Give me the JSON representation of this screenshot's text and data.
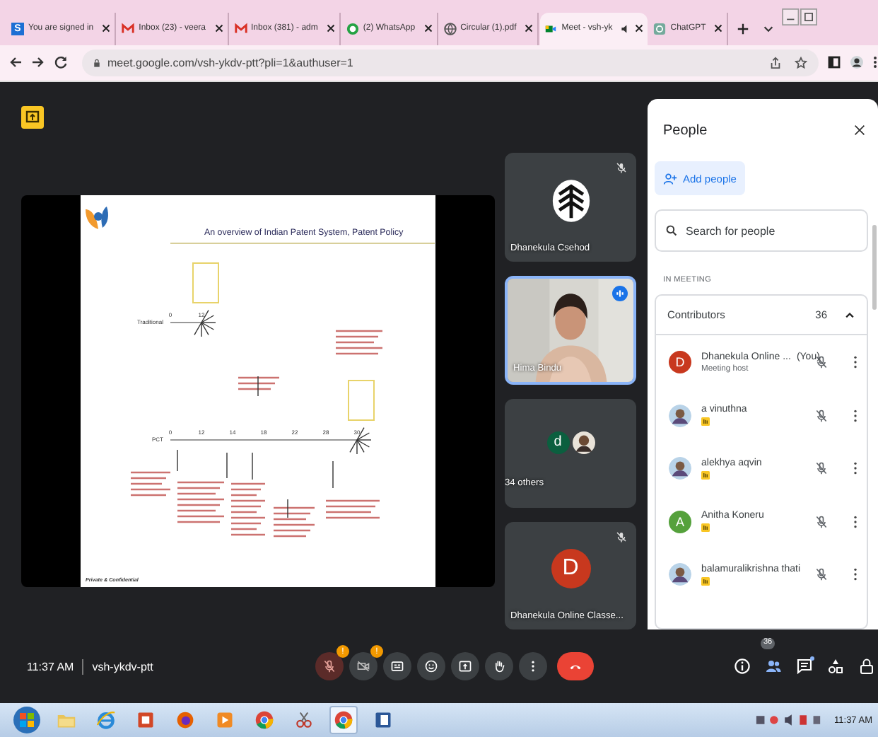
{
  "browser": {
    "tabs": [
      {
        "title": "You are signed in",
        "kind": "letter",
        "icon_text": "S",
        "selected": false
      },
      {
        "title": "Inbox (23) - veera",
        "kind": "mail",
        "selected": false
      },
      {
        "title": "Inbox (381) - adm",
        "kind": "mail",
        "selected": false
      },
      {
        "title": "(2) WhatsApp",
        "kind": "chat",
        "selected": false
      },
      {
        "title": "Circular (1).pdf",
        "kind": "globe",
        "selected": false
      },
      {
        "title": "Meet - vsh-yk",
        "kind": "meet",
        "audio": true,
        "selected": true
      },
      {
        "title": "ChatGPT",
        "kind": "bot",
        "selected": false
      }
    ],
    "url": "meet.google.com/vsh-ykdv-ptt?pli=1&authuser=1"
  },
  "presentation": {
    "title": "An overview of Indian Patent System, Patent Policy",
    "footer": "Private & Confidential",
    "timelines": [
      {
        "label": "Traditional",
        "ticks": [
          "0",
          "12"
        ]
      },
      {
        "label": "PCT",
        "ticks": [
          "0",
          "12",
          "14",
          "18",
          "22",
          "28",
          "30"
        ]
      }
    ]
  },
  "tiles": [
    {
      "kind": "logo",
      "name": "Dhanekula Csehod",
      "muted": true,
      "speaking": false
    },
    {
      "kind": "video",
      "name": "Hima Bindu",
      "muted": false,
      "speaking": true
    },
    {
      "kind": "group",
      "name": "34 others",
      "letter": "d",
      "muted": false,
      "speaking": false
    },
    {
      "kind": "avatar",
      "name": "Dhanekula Online Classe...",
      "letter": "D",
      "muted": true,
      "speaking": false
    }
  ],
  "people": {
    "title": "People",
    "add_button": "Add people",
    "search_placeholder": "Search for people",
    "section": "IN MEETING",
    "group": {
      "label": "Contributors",
      "count": "36",
      "expanded": true
    },
    "participants": [
      {
        "name": "Dhanekula Online ...",
        "you": "(You)",
        "role": "Meeting host",
        "avatar": {
          "kind": "letter",
          "letter": "D",
          "color": "#c8381e"
        },
        "muted": true,
        "badge": false
      },
      {
        "name": "a vinuthna",
        "muted": true,
        "badge": true
      },
      {
        "name": "alekhya aqvin",
        "muted": true,
        "badge": true
      },
      {
        "name": "Anitha Koneru",
        "avatar": {
          "kind": "letter",
          "letter": "A",
          "color": "#55a13c"
        },
        "muted": true,
        "badge": true
      },
      {
        "name": "balamuralikrishna thati",
        "muted": true,
        "badge": true
      }
    ]
  },
  "controls": {
    "time": "11:37 AM",
    "meeting_code": "vsh-ykdv-ptt",
    "buttons": [
      {
        "kind": "mic",
        "on": false,
        "alert": "!"
      },
      {
        "kind": "camera",
        "on": false,
        "alert": "!"
      },
      {
        "kind": "captions",
        "on": false
      },
      {
        "kind": "emoji",
        "on": false
      },
      {
        "kind": "present",
        "on": false
      },
      {
        "kind": "hand",
        "on": false
      },
      {
        "kind": "more",
        "on": false
      },
      {
        "kind": "end"
      }
    ],
    "side": [
      {
        "kind": "info",
        "selected": false
      },
      {
        "kind": "people",
        "selected": true,
        "count": "36"
      },
      {
        "kind": "chat",
        "selected": false,
        "unread": true
      },
      {
        "kind": "activities",
        "selected": false
      },
      {
        "kind": "lock",
        "selected": false
      }
    ]
  },
  "taskbar": {
    "time": "11:37 AM",
    "apps": [
      {
        "kind": "folder",
        "selected": false
      },
      {
        "kind": "ie",
        "selected": false
      },
      {
        "kind": "slides",
        "selected": false
      },
      {
        "kind": "firefox",
        "selected": false
      },
      {
        "kind": "media",
        "selected": false
      },
      {
        "kind": "chrome",
        "selected": false
      },
      {
        "kind": "snip",
        "selected": false
      },
      {
        "kind": "chrome",
        "selected": true
      },
      {
        "kind": "word",
        "selected": false
      }
    ]
  }
}
